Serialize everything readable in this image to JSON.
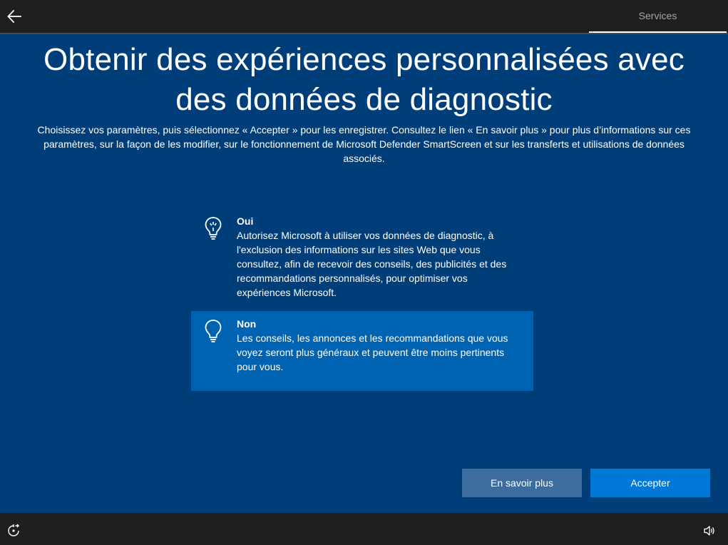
{
  "topbar": {
    "back_icon": "arrow-left-icon",
    "tab_label": "Services"
  },
  "main": {
    "title": "Obtenir des expériences personnalisées avec des données de diagnostic",
    "subtitle": "Choisissez vos paramètres, puis sélectionnez « Accepter » pour les enregistrer. Consultez le lien « En savoir plus » pour plus d’informations sur ces paramètres, sur la façon de les modifier, sur le fonctionnement de Microsoft Defender SmartScreen et sur les transferts et utilisations de données associés.",
    "options": [
      {
        "icon": "lightbulb-on-icon",
        "title": "Oui",
        "description": "Autorisez Microsoft à utiliser vos données de diagnostic, à l'exclusion des informations sur les sites Web que vous consultez, afin de recevoir des conseils, des publicités et des recommandations personnalisés, pour optimiser vos expériences Microsoft.",
        "selected": false
      },
      {
        "icon": "lightbulb-off-icon",
        "title": "Non",
        "description": "Les conseils, les annonces et les recommandations que vous voyez seront plus généraux et peuvent être moins pertinents pour vous.",
        "selected": true
      }
    ],
    "buttons": {
      "learn_more": "En savoir plus",
      "accept": "Accepter"
    }
  },
  "bottombar": {
    "left_icon": "ease-of-access-icon",
    "right_icon": "volume-icon"
  },
  "colors": {
    "main_background": "#003e7a",
    "selected_option": "#0063b1",
    "accent_button": "#0078d7",
    "secondary_button": "#3c6d9e",
    "chrome": "#1f1f1f"
  }
}
